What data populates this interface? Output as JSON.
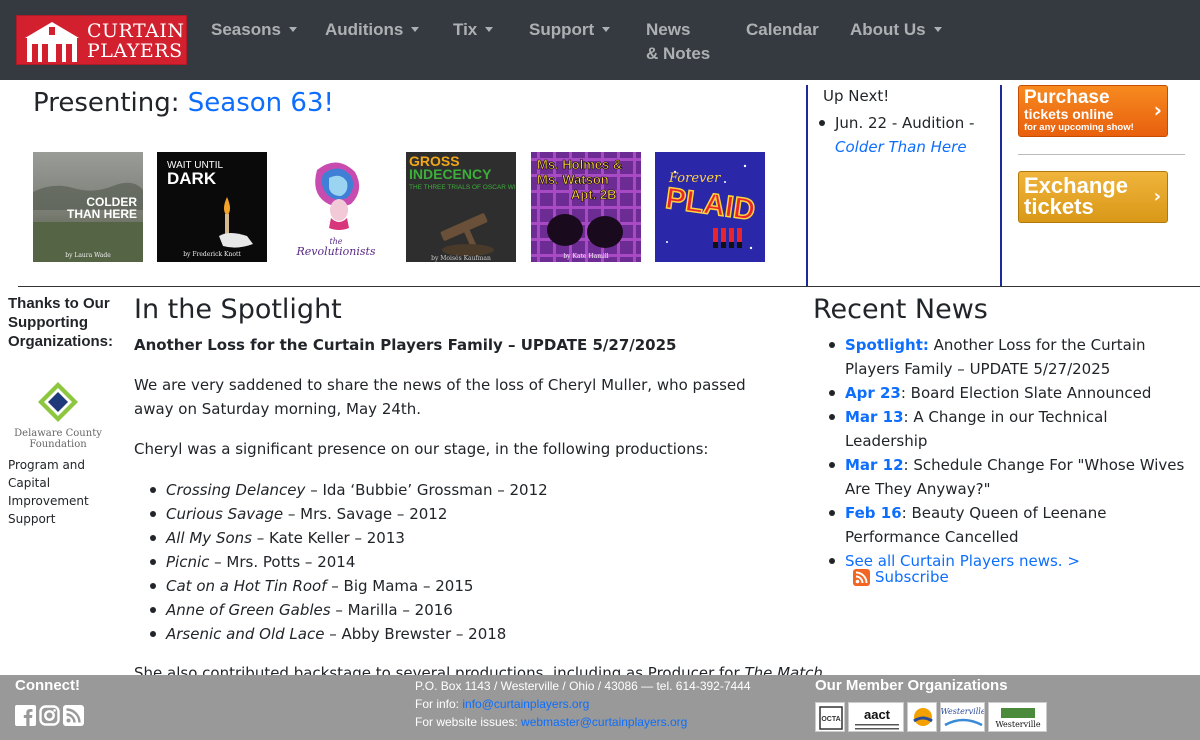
{
  "nav": {
    "logo_line1": "CURTAIN",
    "logo_line2": "PLAYERS",
    "items": [
      {
        "label": "Seasons",
        "dropdown": true
      },
      {
        "label": "Auditions",
        "dropdown": true
      },
      {
        "label": "Tix",
        "dropdown": true
      },
      {
        "label": "Support",
        "dropdown": true
      },
      {
        "label_line1": "News",
        "label_line2": "& Notes",
        "dropdown": false
      },
      {
        "label": "Calendar",
        "dropdown": false
      },
      {
        "label": "About Us",
        "dropdown": true
      }
    ]
  },
  "presenting": {
    "prefix": "Presenting: ",
    "season": "Season 63!"
  },
  "posters": [
    {
      "title": "COLDER THAN HERE",
      "author": "by Laura Wade"
    },
    {
      "title1": "WAIT UNTIL",
      "title2": "DARK",
      "author": "by Frederick Knott"
    },
    {
      "title": "the Revolutionists"
    },
    {
      "title1": "GROSS",
      "title2": "INDECENCY",
      "subtitle": "THE THREE TRIALS OF OSCAR WILDE",
      "author": "by Moisés Kaufman"
    },
    {
      "title1": "Ms. Holmes &",
      "title2": "Ms. Watson",
      "title3": "Apt. 2B",
      "author": "by Kate Hamill"
    },
    {
      "title1": "Forever",
      "title2": "PLAID"
    }
  ],
  "up_next": {
    "title": "Up Next!",
    "item_prefix": "Jun. 22 - Audition -",
    "item_link": "Colder Than Here"
  },
  "buttons": {
    "purchase_big": "Purchase",
    "purchase_mid": "tickets online",
    "purchase_small": "for any upcoming show!",
    "exchange_l1": "Exchange",
    "exchange_l2": "tickets"
  },
  "thanks": {
    "heading": "Thanks to Our Supporting Organizations:",
    "logo_text1": "Delaware County",
    "logo_text2": "Foundation",
    "caption": "Program and Capital Improvement Support"
  },
  "spotlight": {
    "title": "In the Spotlight",
    "headline": "Another Loss for the Curtain Players Family – UPDATE 5/27/2025",
    "para1": "We are very saddened to share the news of the loss of Cheryl Muller, who passed away on Saturday morning, May 24th.",
    "para2": "Cheryl was a significant presence on our stage, in the following productions:",
    "productions": [
      {
        "show": "Crossing Delancey",
        "detail": " – Ida ‘Bubbie’ Grossman – 2012"
      },
      {
        "show": "Curious Savage",
        "detail": " – Mrs. Savage – 2012"
      },
      {
        "show": "All My Sons",
        "detail": " – Kate Keller – 2013"
      },
      {
        "show": "Picnic",
        "detail": " – Mrs. Potts – 2014"
      },
      {
        "show": "Cat on a Hot Tin Roof",
        "detail": " – Big Mama – 2015"
      },
      {
        "show": "Anne of Green Gables",
        "detail": " – Marilla – 2016"
      },
      {
        "show": "Arsenic and Old Lace",
        "detail": " – Abby Brewster – 2018"
      }
    ],
    "para3_start": "She also contributed backstage to several productions, including as Producer for ",
    "para3_show": "The Match"
  },
  "news": {
    "title": "Recent News",
    "items": [
      {
        "date": "Spotlight:",
        "text": " Another Loss for the Curtain Players Family – UPDATE 5/27/2025"
      },
      {
        "date": "Apr 23",
        "text": ": Board Election Slate Announced"
      },
      {
        "date": "Mar 13",
        "text": ": A Change in our Technical Leadership"
      },
      {
        "date": "Mar 12",
        "text": ": Schedule Change For \"Whose Wives Are They Anyway?\""
      },
      {
        "date": "Feb 16",
        "text": ": Beauty Queen of Leenane Performance Cancelled"
      }
    ],
    "see_all": "See all Curtain Players news. >",
    "subscribe": "Subscribe"
  },
  "footer": {
    "connect": "Connect!",
    "address": "P.O. Box 1143 / Westerville / Ohio / 43086 — tel. 614-392-7444",
    "info_label": "For info: ",
    "info_email": "info@curtainplayers.org",
    "web_label": "For website issues: ",
    "web_email": "webmaster@curtainplayers.org",
    "member_title": "Our Member Organizations",
    "member_logos": [
      "OCTA",
      "aact",
      "",
      "Westerville",
      "Westerville"
    ]
  },
  "colors": {
    "nav_bg": "#343a40",
    "brand_red": "#d3202f",
    "link": "#0d6efd",
    "footer_bg": "#999999",
    "purchase": "#f07a18",
    "exchange": "#e5a827"
  }
}
